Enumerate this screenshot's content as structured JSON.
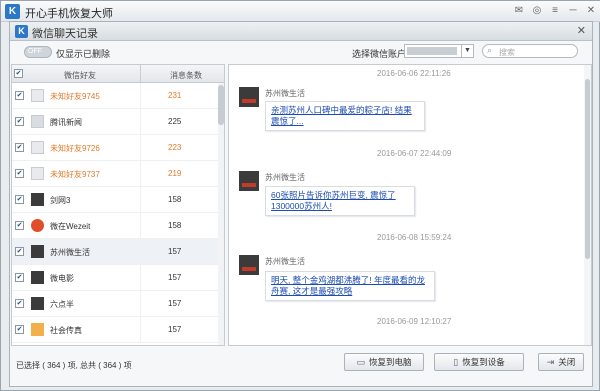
{
  "app": {
    "title": "开心手机恢复大师",
    "logo": "K"
  },
  "dialog": {
    "title": "微信聊天记录",
    "logo": "K"
  },
  "toolbar": {
    "toggle_text": "OFF",
    "toggle_label": "仅显示已删除",
    "account_label": "选择微信账户",
    "search_placeholder": "搜索"
  },
  "list": {
    "header_friend": "微信好友",
    "header_count": "消息条数",
    "items": [
      {
        "name": "未知好友9745",
        "count": "231"
      },
      {
        "name": "腾讯新闻",
        "count": "225"
      },
      {
        "name": "未知好友9726",
        "count": "223"
      },
      {
        "name": "未知好友9737",
        "count": "219"
      },
      {
        "name": "剑网3",
        "count": "158"
      },
      {
        "name": "微在Wezeit",
        "count": "158"
      },
      {
        "name": "苏州微生活",
        "count": "157"
      },
      {
        "name": "微电影",
        "count": "157"
      },
      {
        "name": "六点半",
        "count": "157"
      },
      {
        "name": "社会传真",
        "count": "157"
      }
    ]
  },
  "chat": {
    "messages": [
      {
        "time": "2016-06-06 22:11:26",
        "sender": "苏州微生活",
        "text": "亲测苏州人口碑中最爱的粽子店! 结果震惊了..."
      },
      {
        "time": "2016-06-07 22:44:09",
        "sender": "苏州微生活",
        "text": "60张照片告诉你苏州巨变, 震惊了1300000苏州人!"
      },
      {
        "time": "2016-06-08 15:59:24",
        "sender": "苏州微生活",
        "text": "明天, 整个金鸡湖都沸腾了! 年度最看的龙舟赛, 这才是最强攻略"
      },
      {
        "time": "2016-06-09 12:10:27"
      }
    ]
  },
  "footer": {
    "status": "已选择 ( 364 ) 项, 总共 ( 364 ) 项",
    "restore_pc": "恢复到电脑",
    "restore_device": "恢复到设备",
    "close": "关闭"
  }
}
